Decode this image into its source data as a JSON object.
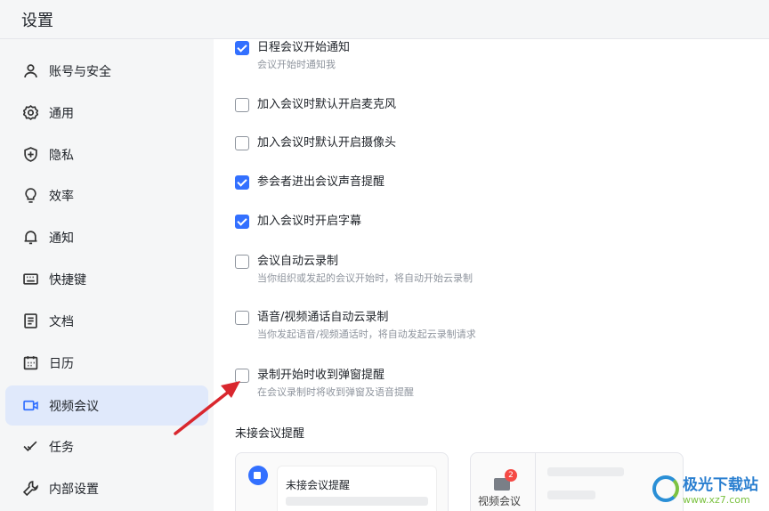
{
  "window": {
    "title": "设置"
  },
  "sidebar": {
    "items": [
      {
        "label": "账号与安全",
        "icon": "user-icon"
      },
      {
        "label": "通用",
        "icon": "gear-icon"
      },
      {
        "label": "隐私",
        "icon": "shield-icon"
      },
      {
        "label": "效率",
        "icon": "lightbulb-icon"
      },
      {
        "label": "通知",
        "icon": "bell-icon"
      },
      {
        "label": "快捷键",
        "icon": "keyboard-icon"
      },
      {
        "label": "文档",
        "icon": "document-icon"
      },
      {
        "label": "日历",
        "icon": "calendar-icon"
      },
      {
        "label": "视频会议",
        "icon": "video-icon",
        "active": true
      },
      {
        "label": "任务",
        "icon": "check-icon"
      },
      {
        "label": "内部设置",
        "icon": "wrench-icon"
      }
    ]
  },
  "options": [
    {
      "label": "日程会议开始通知",
      "sub": "会议开始时通知我",
      "checked": true
    },
    {
      "label": "加入会议时默认开启麦克风",
      "checked": false
    },
    {
      "label": "加入会议时默认开启摄像头",
      "checked": false
    },
    {
      "label": "参会者进出会议声音提醒",
      "checked": true
    },
    {
      "label": "加入会议时开启字幕",
      "checked": true
    },
    {
      "label": "会议自动云录制",
      "sub": "当你组织或发起的会议开始时，将自动开始云录制",
      "checked": false
    },
    {
      "label": "语音/视频通话自动云录制",
      "sub": "当你发起语音/视频通话时，将自动发起云录制请求",
      "checked": false
    },
    {
      "label": "录制开始时收到弹窗提醒",
      "sub": "在会议录制时将收到弹窗及语音提醒",
      "checked": false
    }
  ],
  "section": {
    "title": "未接会议提醒",
    "card1": {
      "title": "未接会议提醒"
    },
    "card2": {
      "badge": "2",
      "label": "视频会议"
    }
  },
  "watermark": {
    "name": "极光下载站",
    "url": "www.xz7.com"
  },
  "colors": {
    "accent": "#3370ff",
    "arrow": "#d9272e",
    "badge": "#f54a45"
  }
}
